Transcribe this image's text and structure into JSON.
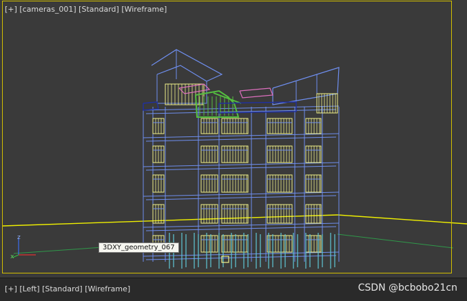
{
  "viewport_top": {
    "plus": "[+]",
    "camera": "[cameras_001]",
    "shading": "[Standard]",
    "mode": "[Wireframe]"
  },
  "viewport_bottom": {
    "plus": "[+]",
    "view": "[Left]",
    "shading": "[Standard]",
    "mode": "[Wireframe]"
  },
  "tooltip": "3DXY_geometry_067",
  "gizmo": {
    "z_label": "z",
    "x_label": "x"
  },
  "watermark": "CSDN @bcbobo21cn",
  "colors": {
    "frame": "#d4c000",
    "wire_blue": "#6f8ff0",
    "wire_yellow": "#f2f28a",
    "wire_green": "#55c040",
    "wire_pink": "#e070c0",
    "horizon": "#f0f000",
    "grid_green": "#2f9a4a"
  },
  "building": {
    "floors": 5,
    "bays": 5
  }
}
